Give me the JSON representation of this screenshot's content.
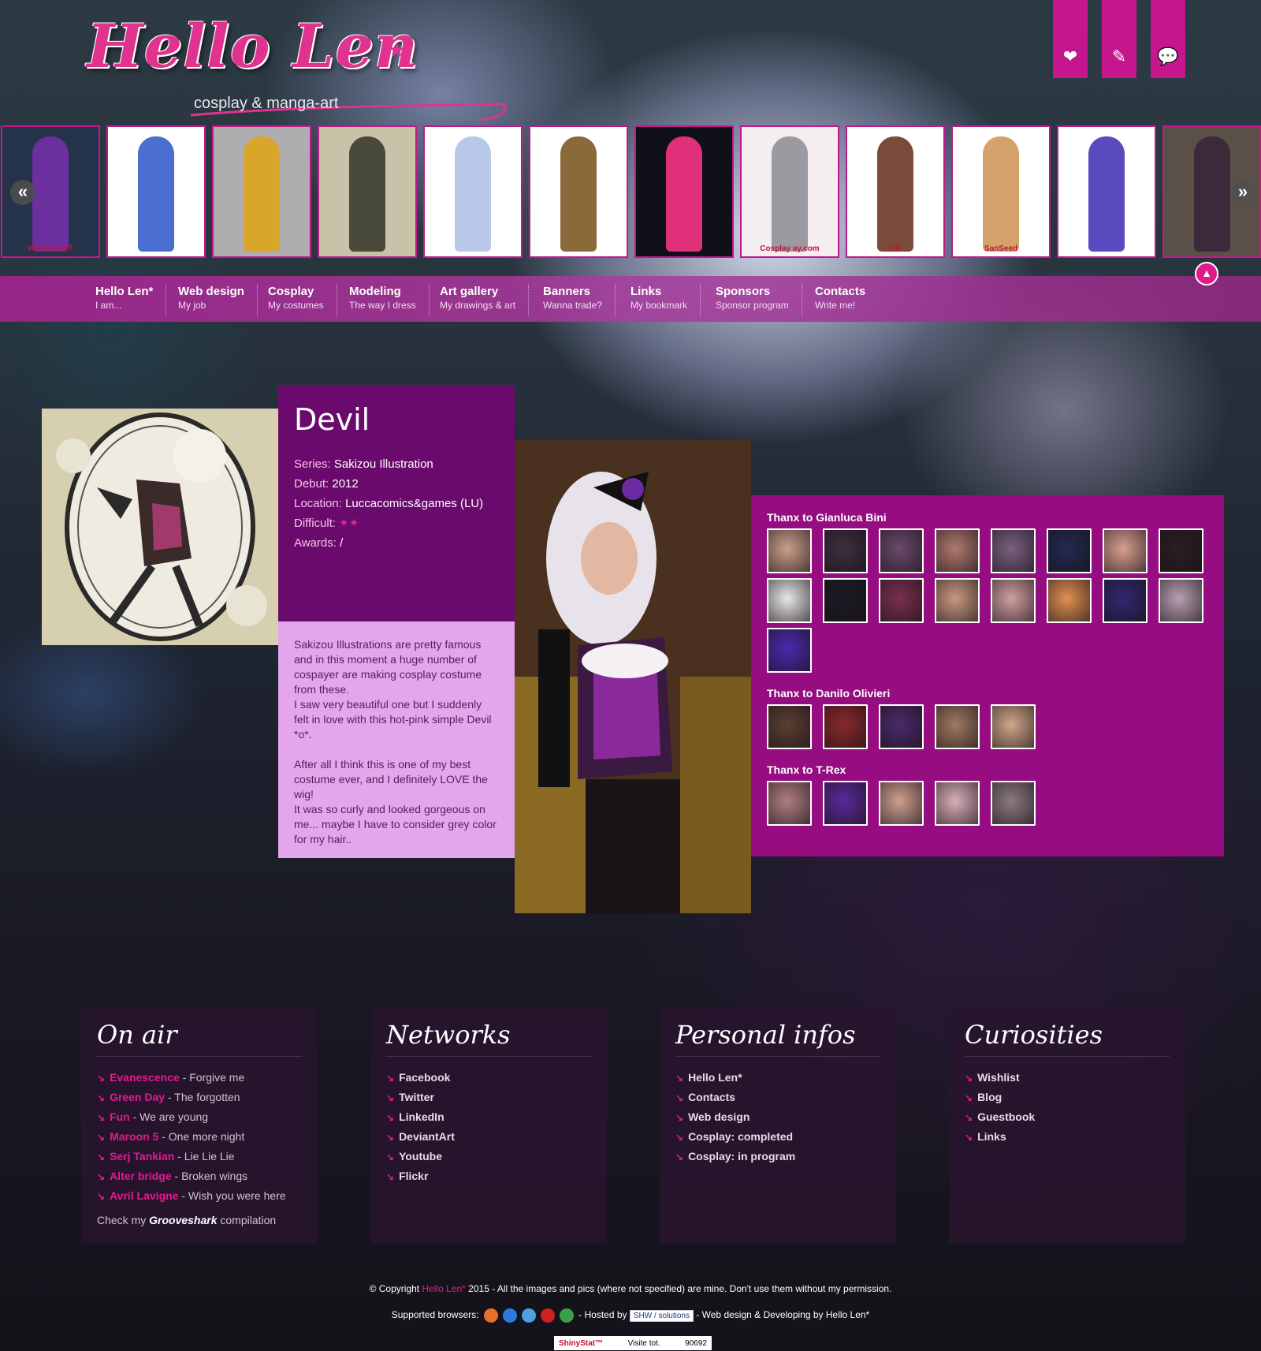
{
  "site": {
    "title": "Hello Len",
    "star": "★",
    "subtitle": "cosplay & manga-art"
  },
  "top_icons": [
    {
      "name": "heart-icon",
      "glyph": "❤"
    },
    {
      "name": "pencil-icon",
      "glyph": "✎"
    },
    {
      "name": "chat-icon",
      "glyph": "💬"
    }
  ],
  "carousel": {
    "prev_label": "«",
    "next_label": "»",
    "thumbs": [
      {
        "bg": "#24324a",
        "fig": "#6b2fa0",
        "tag": "WARCRAFT"
      },
      {
        "bg": "#ffffff",
        "fig": "#4a6fd0",
        "tag": ""
      },
      {
        "bg": "#b0adb0",
        "fig": "#d9a52b",
        "tag": ""
      },
      {
        "bg": "#c8c2a8",
        "fig": "#4a4a3c",
        "tag": ""
      },
      {
        "bg": "#ffffff",
        "fig": "#b8c8e8",
        "tag": ""
      },
      {
        "bg": "#ffffff",
        "fig": "#8a6a3a",
        "tag": ""
      },
      {
        "bg": "#101018",
        "fig": "#e0307a",
        "tag": ""
      },
      {
        "bg": "#f4eef0",
        "fig": "#9a9aa0",
        "tag": "Cosplay ay.com"
      },
      {
        "bg": "#ffffff",
        "fig": "#7a4a3a",
        "tag": "CS"
      },
      {
        "bg": "#ffffff",
        "fig": "#d4a26a",
        "tag": "SanSeed"
      },
      {
        "bg": "#ffffff",
        "fig": "#5a4ac0",
        "tag": ""
      },
      {
        "bg": "#5a5048",
        "fig": "#3a2a3a",
        "tag": ""
      }
    ]
  },
  "nav": [
    {
      "title": "Hello Len*",
      "sub": "I am..."
    },
    {
      "title": "Web design",
      "sub": "My job"
    },
    {
      "title": "Cosplay",
      "sub": "My costumes"
    },
    {
      "title": "Modeling",
      "sub": "The way I dress"
    },
    {
      "title": "Art gallery",
      "sub": "My drawings & art"
    },
    {
      "title": "Banners",
      "sub": "Wanna trade?"
    },
    {
      "title": "Links",
      "sub": "My bookmark"
    },
    {
      "title": "Sponsors",
      "sub": "Sponsor program"
    },
    {
      "title": "Contacts",
      "sub": "Write me!"
    }
  ],
  "costume": {
    "name": "Devil",
    "details": [
      {
        "key": "Series:",
        "value": "Sakizou Illustration"
      },
      {
        "key": "Debut:",
        "value": "2012"
      },
      {
        "key": "Location:",
        "value": "Luccacomics&games (LU)"
      },
      {
        "key": "Difficult:",
        "value": "✴✴"
      },
      {
        "key": "Awards:",
        "value": "/"
      }
    ],
    "description": "Sakizou Illustrations are pretty famous and in this moment a huge number of cospayer are making cosplay costume from these.\nI saw very beautiful one but I suddenly felt in love with this hot-pink simple Devil *o*.\n\nAfter all I think this is one of my best costume ever, and I definitely LOVE the wig!\nIt was so curly and looked gorgeous on me... maybe I have to consider grey color for my hair.."
  },
  "thanks": [
    {
      "title": "Thanx to Gianluca Bini",
      "colors": [
        "#c9a08a",
        "#3a3040",
        "#6a4a6a",
        "#b07a70",
        "#7a6080",
        "#202a50",
        "#d8a090",
        "#2a2020",
        "#e8e8e8",
        "#1a1a22",
        "#7a3050",
        "#c89a80",
        "#d0a0a0",
        "#e09050",
        "#302870",
        "#b8a0b0",
        "#4a2ab0"
      ]
    },
    {
      "title": "Thanx to Danilo Olivieri",
      "colors": [
        "#5a4030",
        "#8a2a2a",
        "#4a2a6a",
        "#a07a60",
        "#d0a888"
      ]
    },
    {
      "title": "Thanx to T-Rex",
      "colors": [
        "#b08080",
        "#5a2a9a",
        "#d0a090",
        "#d8b0b8",
        "#8a7a80"
      ]
    }
  ],
  "footer_boxes": [
    {
      "title": "On air",
      "items": [
        {
          "artist": "Evanescence",
          "song": " - Forgive me"
        },
        {
          "artist": "Green Day",
          "song": " - The forgotten"
        },
        {
          "artist": "Fun",
          "song": " - We are young"
        },
        {
          "artist": "Maroon 5",
          "song": " - One more night"
        },
        {
          "artist": "Serj Tankian",
          "song": " - Lie Lie Lie"
        },
        {
          "artist": "Alter bridge",
          "song": " - Broken wings"
        },
        {
          "artist": "Avril Lavigne",
          "song": " - Wish you were here"
        }
      ],
      "note_pre": "Check my ",
      "note_brand": "Grooveshark",
      "note_post": " compilation"
    },
    {
      "title": "Networks",
      "items": [
        "Facebook",
        "Twitter",
        "LinkedIn",
        "DeviantArt",
        "Youtube",
        "Flickr"
      ]
    },
    {
      "title": "Personal infos",
      "items": [
        "Hello Len*",
        "Contacts",
        "Web design",
        "Cosplay: completed",
        "Cosplay: in program"
      ]
    },
    {
      "title": "Curiosities",
      "items": [
        "Wishlist",
        "Blog",
        "Guestbook",
        "Links"
      ]
    }
  ],
  "bottom": {
    "copy_pre": "© Copyright ",
    "copy_brand": "Hello Len*",
    "copy_post": " 2015 - All the images and pics (where not specified) are mine. Don't use them without my permission.",
    "browsers_label": "Supported browsers: ",
    "hosted_label": " - Hosted by ",
    "hosted_badge": "SHW / solutions",
    "design_label": " - Web design & Developing by ",
    "design_brand": "Hello Len*",
    "browser_colors": [
      "#e8702a",
      "#2a7ae0",
      "#4aa0e0",
      "#d02020",
      "#3aa04a"
    ],
    "counter_brand": "ShinyStat™",
    "counter_label": "Visite tot.",
    "counter_value": "90692"
  },
  "colors": {
    "accent": "#c4178e",
    "info_bg": "#6a0a6d",
    "desc_bg": "#e3a6eb",
    "thanks_bg": "#960c81"
  }
}
